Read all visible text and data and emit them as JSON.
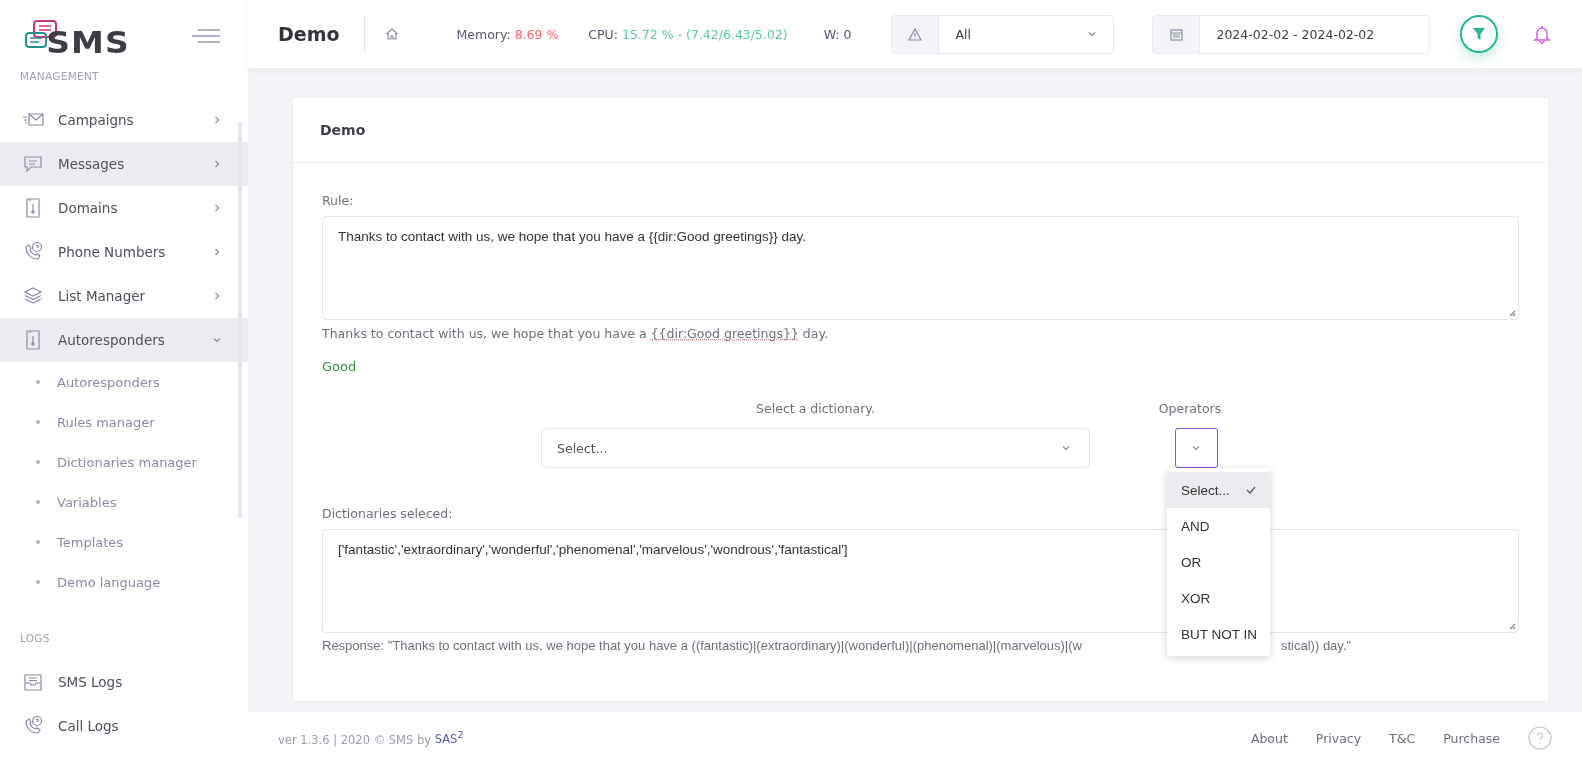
{
  "logo": {
    "text": "SMS"
  },
  "sidebar": {
    "sections": [
      {
        "title": "MANAGEMENT",
        "items": [
          {
            "label": "Campaigns",
            "selected": false,
            "expanded": false
          },
          {
            "label": "Messages",
            "selected": true,
            "expanded": false
          },
          {
            "label": "Domains",
            "selected": false,
            "expanded": false
          },
          {
            "label": "Phone Numbers",
            "selected": false,
            "expanded": false
          },
          {
            "label": "List Manager",
            "selected": false,
            "expanded": false
          },
          {
            "label": "Autoresponders",
            "selected": true,
            "expanded": true,
            "children": [
              {
                "label": "Autoresponders"
              },
              {
                "label": "Rules manager"
              },
              {
                "label": "Dictionaries manager"
              },
              {
                "label": "Variables"
              },
              {
                "label": "Templates"
              },
              {
                "label": "Demo language"
              }
            ]
          }
        ]
      },
      {
        "title": "LOGS",
        "items": [
          {
            "label": "SMS Logs",
            "selected": false
          },
          {
            "label": "Call Logs",
            "selected": false
          }
        ]
      }
    ]
  },
  "topbar": {
    "title": "Demo",
    "memory_label": "Memory:",
    "memory_value": "8.69 %",
    "cpu_label": "CPU:",
    "cpu_value": "15.72 % - (7.42/6.43/5.02)",
    "w": "W: 0",
    "level_filter": {
      "value": "All"
    },
    "date_range": {
      "value": "2024-02-02 - 2024-02-02"
    }
  },
  "card": {
    "title": "Demo",
    "rule_label": "Rule:",
    "rule_value": "Thanks to contact with us, we hope that you have a {{dir:Good greetings}} day.",
    "preview": {
      "before": "Thanks to contact with us, we hope that you have a ",
      "token": "{{dir:Good greetings}}",
      "after": " day."
    },
    "match": "Good",
    "dictionary_label": "Select a dictionary.",
    "dictionary_value": "Select...",
    "operators_label": "Operators",
    "operators_options": [
      {
        "label": "Select...",
        "selected": true
      },
      {
        "label": "AND",
        "selected": false
      },
      {
        "label": "OR",
        "selected": false
      },
      {
        "label": "XOR",
        "selected": false
      },
      {
        "label": "BUT NOT IN",
        "selected": false
      }
    ],
    "selected_label": "Dictionaries seleced:",
    "selected_value": "['fantastic','extraordinary','wonderful','phenomenal','marvelous','wondrous','fantastical']",
    "response_start": "Response: \"Thanks to contact with us, we hope that you have a ((fantastic)|(extraordinary)|(wonderful)|(phenomenal)|(marvelous)|(w",
    "response_end": "stical)) day.\""
  },
  "footer": {
    "text": "ver 1.3.6 | 2020 © SMS by",
    "author_link": "SAS$^{2}$",
    "links": [
      "About",
      "Privacy",
      "T&C",
      "Purchase"
    ]
  }
}
